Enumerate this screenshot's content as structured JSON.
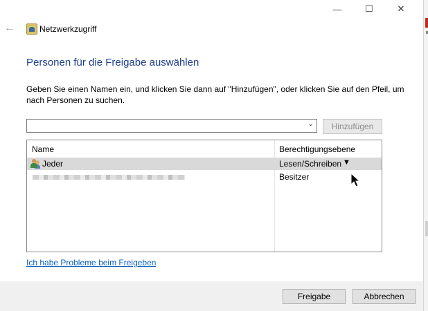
{
  "window": {
    "title": "Netzwerkzugriff",
    "controls": {
      "minimize": "—",
      "maximize": "☐",
      "close": "✕"
    },
    "back": "←"
  },
  "main": {
    "heading": "Personen für die Freigabe auswählen",
    "instruction": "Geben Sie einen Namen ein, und klicken Sie dann auf \"Hinzufügen\", oder klicken Sie auf den Pfeil, um nach Personen zu suchen.",
    "combo": {
      "value": "",
      "arrow": "⌄"
    },
    "add_button": "Hinzufügen"
  },
  "table": {
    "columns": [
      "Name",
      "Berechtigungsebene"
    ],
    "rows": [
      {
        "name": "Jeder",
        "permission": "Lesen/Schreiben",
        "dropdown": "▼"
      },
      {
        "name": "",
        "permission": "Besitzer"
      }
    ]
  },
  "footer": {
    "help_link": "Ich habe Probleme beim Freigeben",
    "share_button": "Freigabe",
    "cancel_button": "Abbrechen"
  },
  "colors": {
    "heading": "#1d3e8a",
    "link": "#0b62c1",
    "selected_row": "#d9d9d9"
  }
}
